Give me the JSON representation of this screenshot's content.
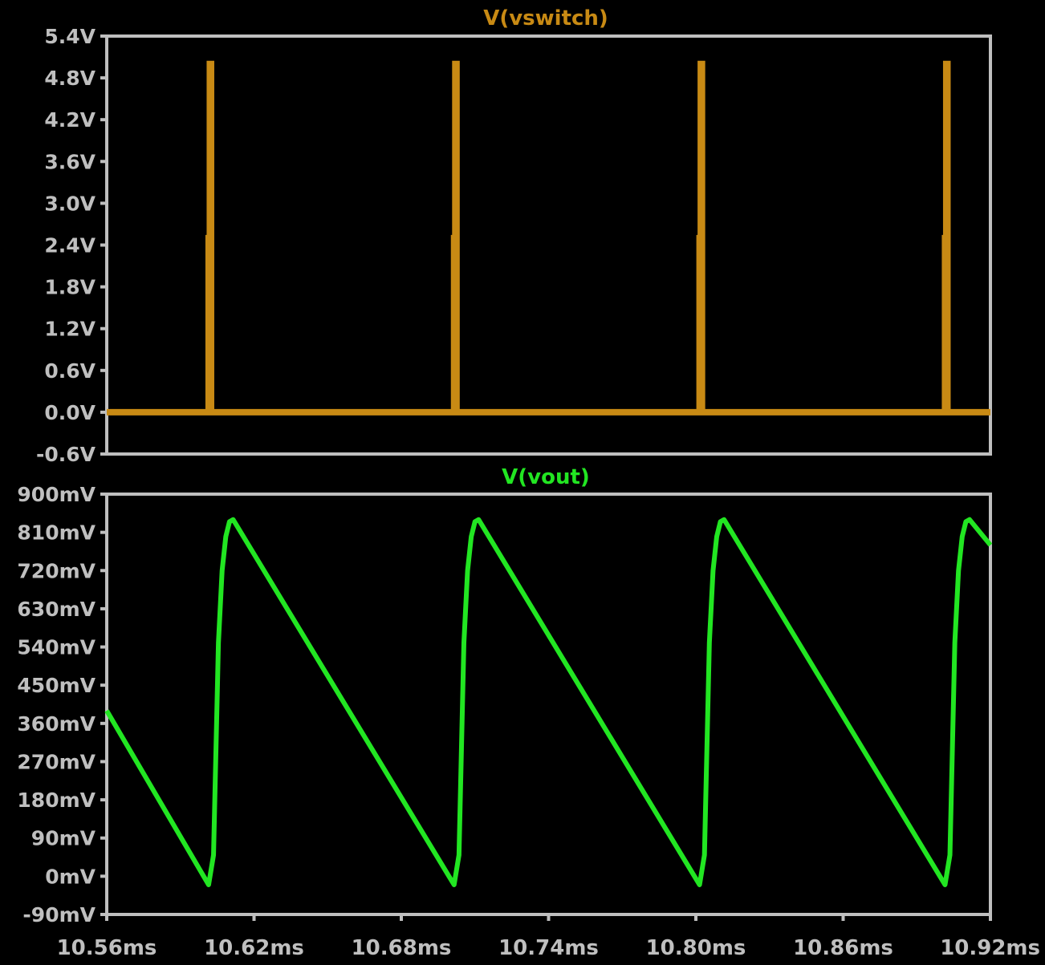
{
  "window": {
    "background": "#000000",
    "frame_color": "#bfbfbf",
    "tick_label_color": "#bfbfbf"
  },
  "chart_data": [
    {
      "type": "line",
      "title": "V(vswitch)",
      "color": "#c88a14",
      "ylim": [
        -0.6,
        5.4
      ],
      "xlim": [
        10.56,
        10.92
      ],
      "y_ticks": [
        5.4,
        4.8,
        4.2,
        3.6,
        3.0,
        2.4,
        1.8,
        1.2,
        0.6,
        0.0,
        -0.6
      ],
      "y_tick_labels": [
        "5.4V",
        "4.8V",
        "4.2V",
        "3.6V",
        "3.0V",
        "2.4V",
        "1.8V",
        "1.2V",
        "0.6V",
        "0.0V",
        "-0.6V"
      ],
      "x_tick_labels": [],
      "grid": false,
      "series": [
        {
          "x": [
            10.56,
            10.6015,
            10.6015,
            10.602,
            10.602,
            10.6025,
            10.6025,
            10.7015,
            10.7015,
            10.702,
            10.702,
            10.7025,
            10.7025,
            10.8015,
            10.8015,
            10.802,
            10.802,
            10.8025,
            10.8025,
            10.9015,
            10.9015,
            10.902,
            10.902,
            10.9025,
            10.9025,
            10.92
          ],
          "values": [
            0,
            0,
            2.5,
            2.5,
            5.0,
            5.0,
            0,
            0,
            2.5,
            2.5,
            5.0,
            5.0,
            0,
            0,
            2.5,
            2.5,
            5.0,
            5.0,
            0,
            0,
            2.5,
            2.5,
            5.0,
            5.0,
            0,
            0
          ]
        }
      ]
    },
    {
      "type": "line",
      "title": "V(vout)",
      "color": "#22e622",
      "ylim": [
        -0.09,
        0.9
      ],
      "xlim": [
        10.56,
        10.92
      ],
      "y_ticks": [
        0.9,
        0.81,
        0.72,
        0.63,
        0.54,
        0.45,
        0.36,
        0.27,
        0.18,
        0.09,
        0.0,
        -0.09
      ],
      "y_tick_labels": [
        "900mV",
        "810mV",
        "720mV",
        "630mV",
        "540mV",
        "450mV",
        "360mV",
        "270mV",
        "180mV",
        "90mV",
        "0mV",
        "-90mV"
      ],
      "x_ticks": [
        10.56,
        10.62,
        10.68,
        10.74,
        10.8,
        10.86,
        10.92
      ],
      "x_tick_labels": [
        "10.56ms",
        "10.62ms",
        "10.68ms",
        "10.74ms",
        "10.80ms",
        "10.86ms",
        "10.92ms"
      ],
      "grid": false,
      "series": [
        {
          "x": [
            10.56,
            10.6015,
            10.6035,
            10.6045,
            10.6055,
            10.607,
            10.6085,
            10.61,
            10.6115,
            10.7015,
            10.7035,
            10.7045,
            10.7055,
            10.707,
            10.7085,
            10.71,
            10.7115,
            10.8015,
            10.8035,
            10.8045,
            10.8055,
            10.807,
            10.8085,
            10.81,
            10.8115,
            10.9015,
            10.9035,
            10.9045,
            10.9055,
            10.907,
            10.9085,
            10.91,
            10.9115,
            10.92
          ],
          "values": [
            0.39,
            -0.02,
            0.05,
            0.3,
            0.55,
            0.72,
            0.8,
            0.835,
            0.84,
            -0.02,
            0.05,
            0.3,
            0.55,
            0.72,
            0.8,
            0.835,
            0.84,
            -0.02,
            0.05,
            0.3,
            0.55,
            0.72,
            0.8,
            0.835,
            0.84,
            -0.02,
            0.05,
            0.3,
            0.55,
            0.72,
            0.8,
            0.835,
            0.84,
            0.78
          ]
        }
      ]
    }
  ]
}
